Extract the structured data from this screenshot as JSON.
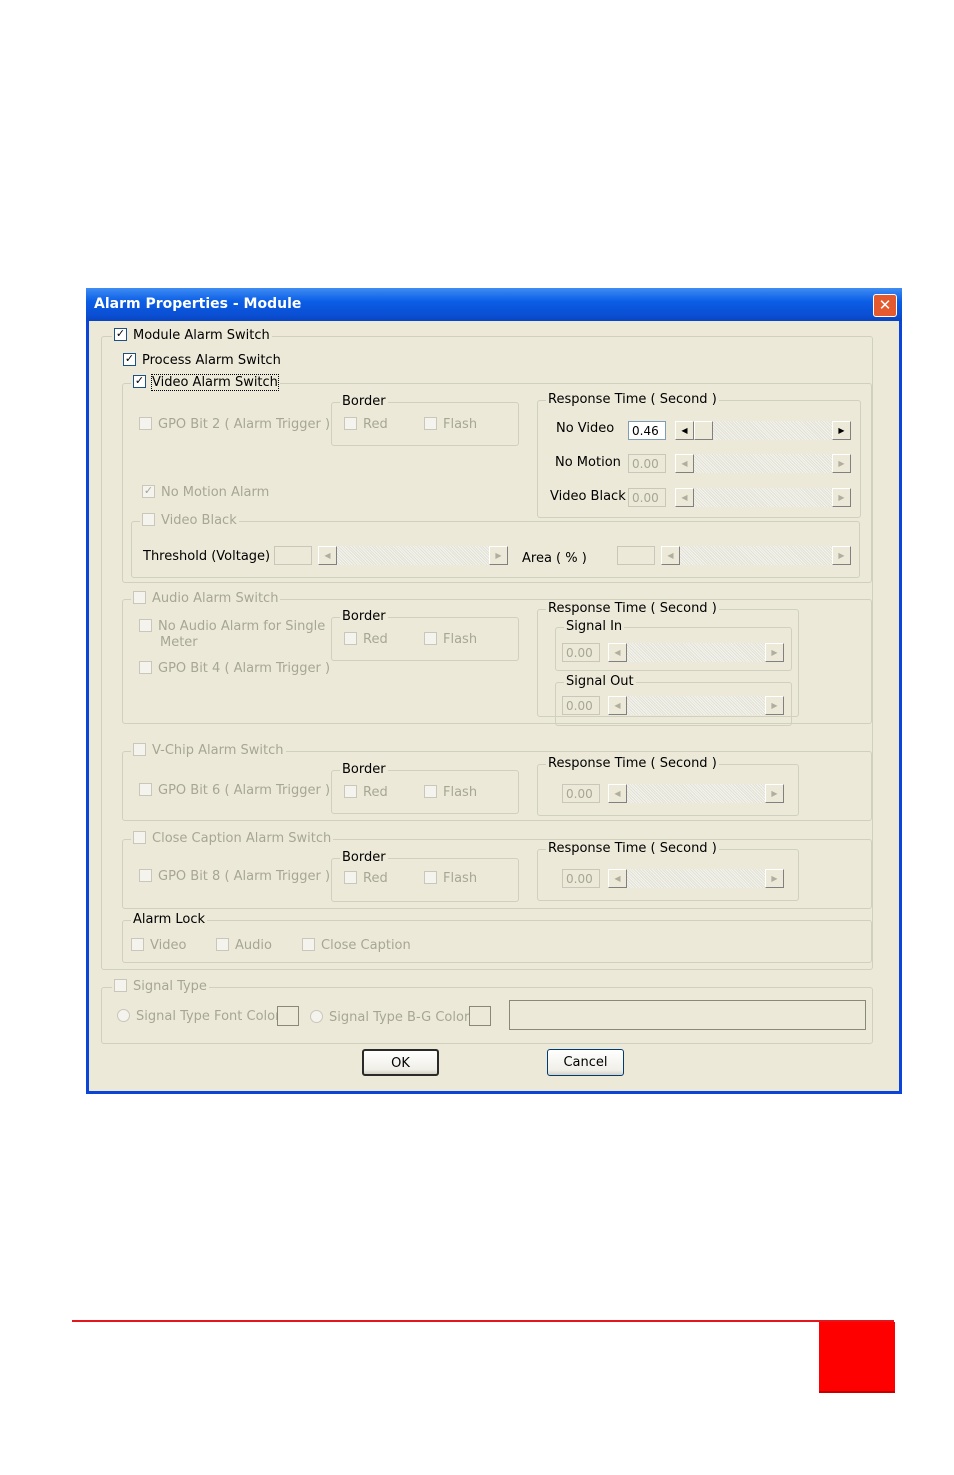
{
  "window": {
    "title": "Alarm Properties - Module",
    "close_glyph": "✕"
  },
  "module_alarm_switch": {
    "label": "Module Alarm Switch",
    "checked": true
  },
  "process_alarm_switch": {
    "label": "Process Alarm Switch",
    "checked": true
  },
  "video": {
    "switch_label": "Video Alarm Switch",
    "gpo_label": "GPO Bit 2  ( Alarm Trigger )",
    "border": {
      "title": "Border",
      "red": "Red",
      "flash": "Flash"
    },
    "response": {
      "title": "Response Time ( Second )",
      "no_video": {
        "label": "No Video",
        "value": "0.46"
      },
      "no_motion": {
        "label": "No Motion",
        "value": "0.00"
      },
      "video_black": {
        "label": "Video Black",
        "value": "0.00"
      }
    },
    "no_motion_alarm": "No Motion Alarm",
    "video_black_group": {
      "title": "Video Black",
      "threshold_label": "Threshold (Voltage)",
      "area_label": "Area ( % )"
    }
  },
  "audio": {
    "switch_label": "Audio Alarm Switch",
    "no_audio_line1": "No Audio Alarm for Single",
    "no_audio_line2": "Meter",
    "gpo_label": "GPO Bit 4  ( Alarm Trigger )",
    "border": {
      "title": "Border",
      "red": "Red",
      "flash": "Flash"
    },
    "response": {
      "title": "Response Time ( Second )",
      "signal_in": {
        "label": "Signal In",
        "value": "0.00"
      },
      "signal_out": {
        "label": "Signal Out",
        "value": "0.00"
      }
    }
  },
  "vchip": {
    "switch_label": "V-Chip Alarm Switch",
    "gpo_label": "GPO Bit 6  ( Alarm Trigger )",
    "border": {
      "title": "Border",
      "red": "Red",
      "flash": "Flash"
    },
    "response": {
      "title": "Response Time ( Second )",
      "value": "0.00"
    }
  },
  "cc": {
    "switch_label": "Close Caption Alarm Switch",
    "gpo_label": "GPO Bit 8  ( Alarm Trigger )",
    "border": {
      "title": "Border",
      "red": "Red",
      "flash": "Flash"
    },
    "response": {
      "title": "Response Time ( Second )",
      "value": "0.00"
    }
  },
  "alarm_lock": {
    "title": "Alarm Lock",
    "video": "Video",
    "audio": "Audio",
    "close_caption": "Close Caption"
  },
  "signal_type": {
    "title": "Signal Type",
    "font_color": "Signal Type Font Color",
    "bg_color": "Signal Type B-G Color"
  },
  "buttons": {
    "ok": "OK",
    "cancel": "Cancel"
  },
  "colors": {
    "title_bar": "#0a5ee6",
    "dialog_bg": "#ece9d8",
    "footer_red": "#ff0000"
  }
}
